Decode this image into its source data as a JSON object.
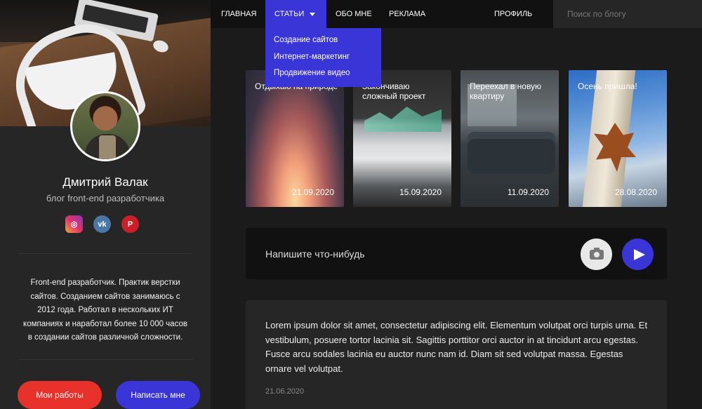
{
  "nav": {
    "home": "ГЛАВНАЯ",
    "articles": "СТАТЬИ",
    "about": "ОБО МНЕ",
    "ads": "РЕКЛАМА",
    "profile": "ПРОФИЛЬ"
  },
  "search": {
    "placeholder": "Поиск по блогу"
  },
  "dropdown": {
    "items": [
      "Создание сайтов",
      "Интернет-маркетинг",
      "Продвижение видео"
    ]
  },
  "profile": {
    "name": "Дмитрий Валак",
    "subtitle": "блог front-end разработчика",
    "socials": [
      "instagram-icon",
      "vk-icon",
      "pinterest-icon"
    ],
    "about": "Front-end разработчик. Практик верстки сайтов.  Созданием сайтов занимаюсь с 2012 года. Работал в нескольких ИТ компаниях и наработал более 10 000 часов в создании сайтов различной сложности.",
    "btn_works": "Мои работы",
    "btn_write": "Написать мне"
  },
  "cards": [
    {
      "title": "Отдыхаю на природе",
      "date": "21.09.2020"
    },
    {
      "title": "Закончиваю сложный проект",
      "date": "15.09.2020"
    },
    {
      "title": "Переехал в новую квартиру",
      "date": "11.09.2020"
    },
    {
      "title": "Осень пришла!",
      "date": "28.08.2020"
    }
  ],
  "composer": {
    "placeholder": "Напишите что-нибудь"
  },
  "post": {
    "text": "Lorem ipsum dolor sit amet, consectetur adipiscing elit. Elementum volutpat orci turpis urna. Et vestibulum, posuere tortor lacinia sit. Sagittis porttitor orci auctor in at tincidunt arcu egestas. Fusce arcu sodales lacinia eu auctor nunc nam id. Diam sit sed volutpat massa. Egestas ornare vel volutpat.",
    "date": "21.06.2020"
  },
  "colors": {
    "accent": "#3a35d6",
    "red": "#e8312a",
    "bg": "#1b1b1b",
    "sidebar": "#262626"
  }
}
